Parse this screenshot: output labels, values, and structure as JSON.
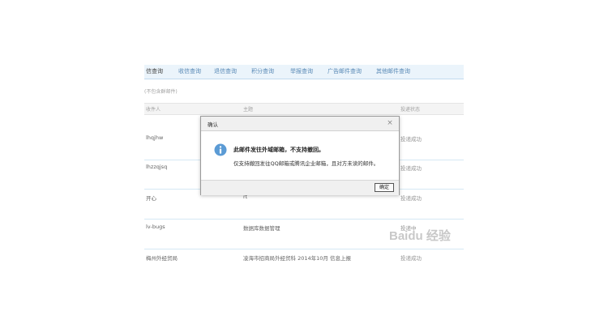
{
  "tabs": [
    {
      "label": "信查询",
      "active": true
    },
    {
      "label": "收信查询"
    },
    {
      "label": "退信查询"
    },
    {
      "label": "积分查询"
    },
    {
      "label": "举报查询"
    },
    {
      "label": "广告邮件查询"
    },
    {
      "label": "其他邮件查询"
    }
  ],
  "hint": "(不包含群邮件)",
  "table": {
    "headers": [
      "收件人",
      "主题",
      "投递状态"
    ],
    "rows": [
      {
        "recipient": "lhqjhw",
        "subject": "",
        "status": "投递成功"
      },
      {
        "recipient": "lhzzqjsq",
        "subject": "",
        "status": "投递成功"
      },
      {
        "recipient": "开心",
        "subject": "rt",
        "status": "投递成功"
      },
      {
        "recipient": "lv-bugs",
        "subject": "数据库数据管理",
        "status": "投递中"
      },
      {
        "recipient": "梅州外经贸局",
        "subject": "凌海市招商局外经贸科 2014年10月 信息上报",
        "status": "投递成功"
      }
    ]
  },
  "dialog": {
    "title": "确认",
    "close_symbol": "×",
    "message": "此邮件发往外域邮箱，不支持撤回。",
    "detail": "仅支持撤回发往QQ邮箱或腾讯企业邮箱，且对方未读的邮件。",
    "ok_label": "确定"
  },
  "watermark": "Baidu 经验",
  "colors": {
    "accent": "#4a7fb0",
    "info_icon": "#5b9bd5"
  }
}
